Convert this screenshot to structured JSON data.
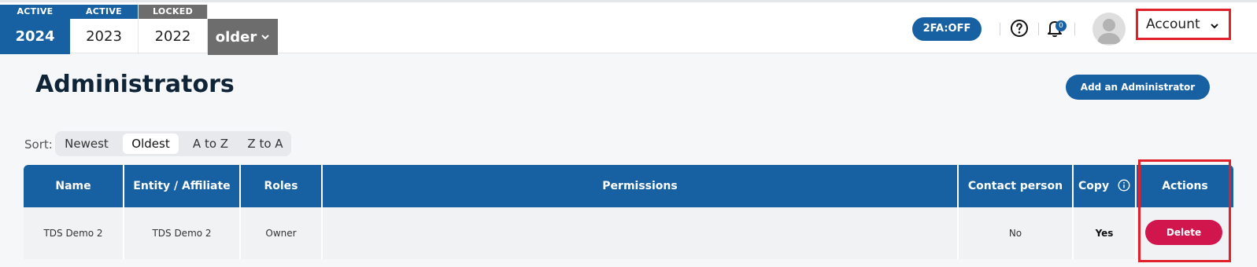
{
  "years": [
    {
      "status": "ACTIVE",
      "label": "2024"
    },
    {
      "status": "ACTIVE",
      "label": "2023"
    },
    {
      "status": "LOCKED",
      "label": "2022"
    }
  ],
  "older_label": "older",
  "header": {
    "twofa_label": "2FA:OFF",
    "notification_count": "0",
    "account_label": "Account"
  },
  "page": {
    "title": "Administrators",
    "add_button": "Add an Administrator"
  },
  "sort": {
    "label": "Sort:",
    "options": [
      "Newest",
      "Oldest",
      "A to Z",
      "Z to A"
    ],
    "selected": "Oldest"
  },
  "table": {
    "columns": [
      "Name",
      "Entity / Affiliate",
      "Roles",
      "Permissions",
      "Contact person",
      "Copy",
      "Actions"
    ],
    "rows": [
      {
        "name": "TDS Demo 2",
        "entity": "TDS Demo 2",
        "role": "Owner",
        "permissions": "",
        "contact": "No",
        "copy": "Yes",
        "action": "Delete"
      }
    ]
  },
  "colors": {
    "primary": "#1760a2",
    "locked": "#6d6d6d",
    "danger": "#d1154d",
    "highlight": "#e0202a"
  }
}
